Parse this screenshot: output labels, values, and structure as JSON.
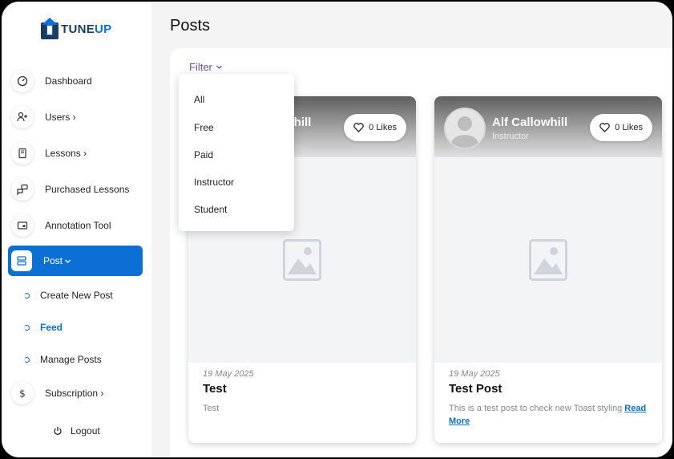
{
  "brand": {
    "name_part1": "TUNE",
    "name_part2": "UP"
  },
  "sidebar": {
    "items": [
      {
        "label": "Dashboard"
      },
      {
        "label": "Users ›"
      },
      {
        "label": "Lessons ›"
      },
      {
        "label": "Purchased Lessons"
      },
      {
        "label": "Annotation Tool"
      },
      {
        "label": "Post"
      }
    ],
    "sub_items": [
      {
        "label": "Create New Post"
      },
      {
        "label": "Feed"
      },
      {
        "label": "Manage Posts"
      }
    ],
    "subscription": "Subscription ›",
    "logout": "Logout"
  },
  "page": {
    "title": "Posts"
  },
  "filter": {
    "label": "Filter",
    "options": [
      "All",
      "Free",
      "Paid",
      "Instructor",
      "Student"
    ]
  },
  "cards": [
    {
      "author": "whill",
      "likes": "0 Likes",
      "date": "19 May 2025",
      "title": "Test",
      "description": "Test"
    },
    {
      "author": "Alf Callowhill",
      "role": "Instructor",
      "likes": "0 Likes",
      "date": "19 May 2025",
      "title": "Test Post",
      "description": "This is a test post to check new Toast styling ",
      "read_more": "Read More"
    }
  ],
  "colors": {
    "accent": "#0b6fd6",
    "filter": "#6b4fbb"
  }
}
